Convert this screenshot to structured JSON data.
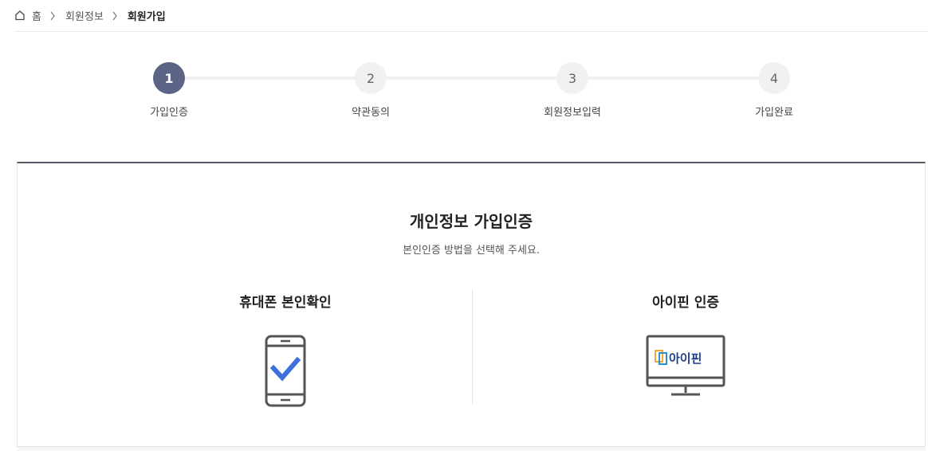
{
  "breadcrumb": {
    "home": "홈",
    "items": [
      "회원정보",
      "회원가입"
    ]
  },
  "steps": [
    {
      "num": "1",
      "label": "가입인증",
      "active": true
    },
    {
      "num": "2",
      "label": "약관동의",
      "active": false
    },
    {
      "num": "3",
      "label": "회원정보입력",
      "active": false
    },
    {
      "num": "4",
      "label": "가입완료",
      "active": false
    }
  ],
  "panel": {
    "title": "개인정보 가입인증",
    "subtitle": "본인인증 방법을 선택해 주세요.",
    "options": [
      {
        "title": "휴대폰 본인확인",
        "icon": "phone-check-icon"
      },
      {
        "title": "아이핀 인증",
        "icon": "ipin-monitor-icon",
        "logo_text": "아이핀"
      }
    ]
  },
  "colors": {
    "active_step": "#5b6485",
    "check_blue": "#3f6fd8",
    "panel_border_top": "#555b66"
  }
}
